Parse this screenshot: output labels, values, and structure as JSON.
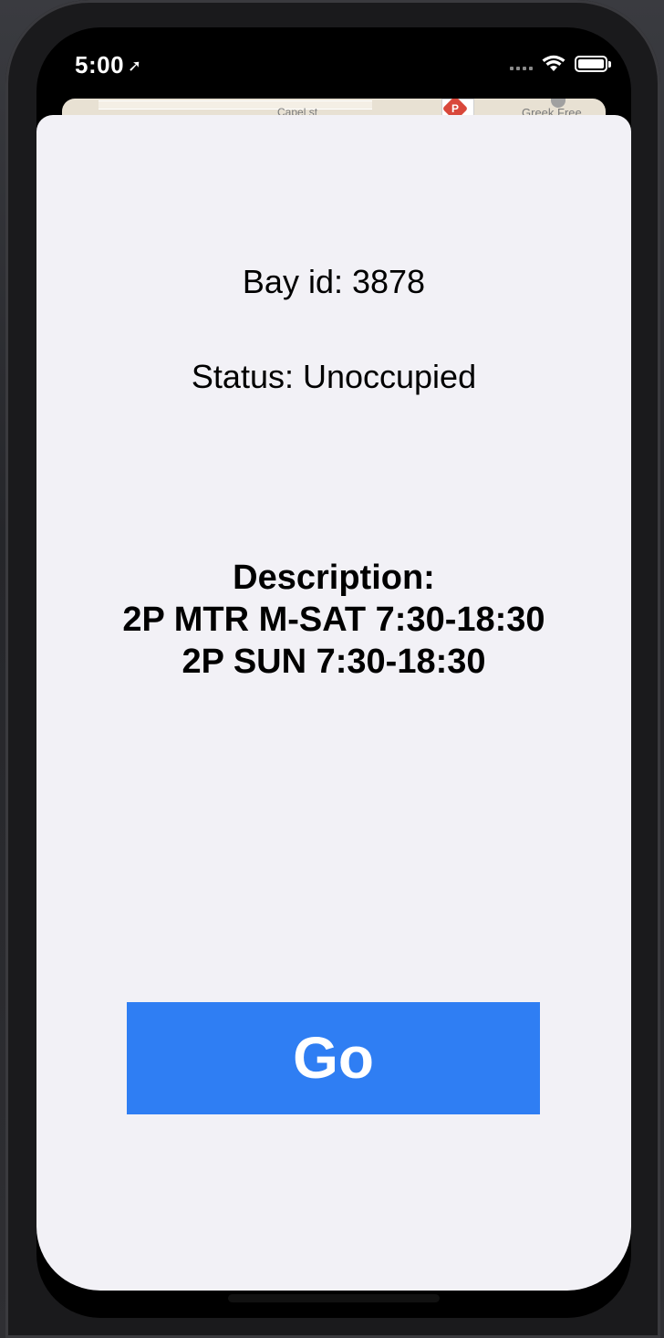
{
  "status_bar": {
    "time": "5:00",
    "location_icon": "location-arrow-icon",
    "wifi_icon": "wifi-icon",
    "battery_icon": "battery-icon"
  },
  "map": {
    "label_left": "Capel st",
    "label_right": "Greek Free",
    "parking_marker": "P"
  },
  "detail": {
    "bay_id": "Bay id: 3878",
    "status": "Status: Unoccupied",
    "description_heading": "Description:",
    "description_lines": [
      "2P MTR M-SAT 7:30-18:30",
      "2P SUN 7:30-18:30"
    ]
  },
  "actions": {
    "go_label": "Go"
  },
  "colors": {
    "accent": "#2f7ef3",
    "sheet_background": "#f2f1f6"
  }
}
